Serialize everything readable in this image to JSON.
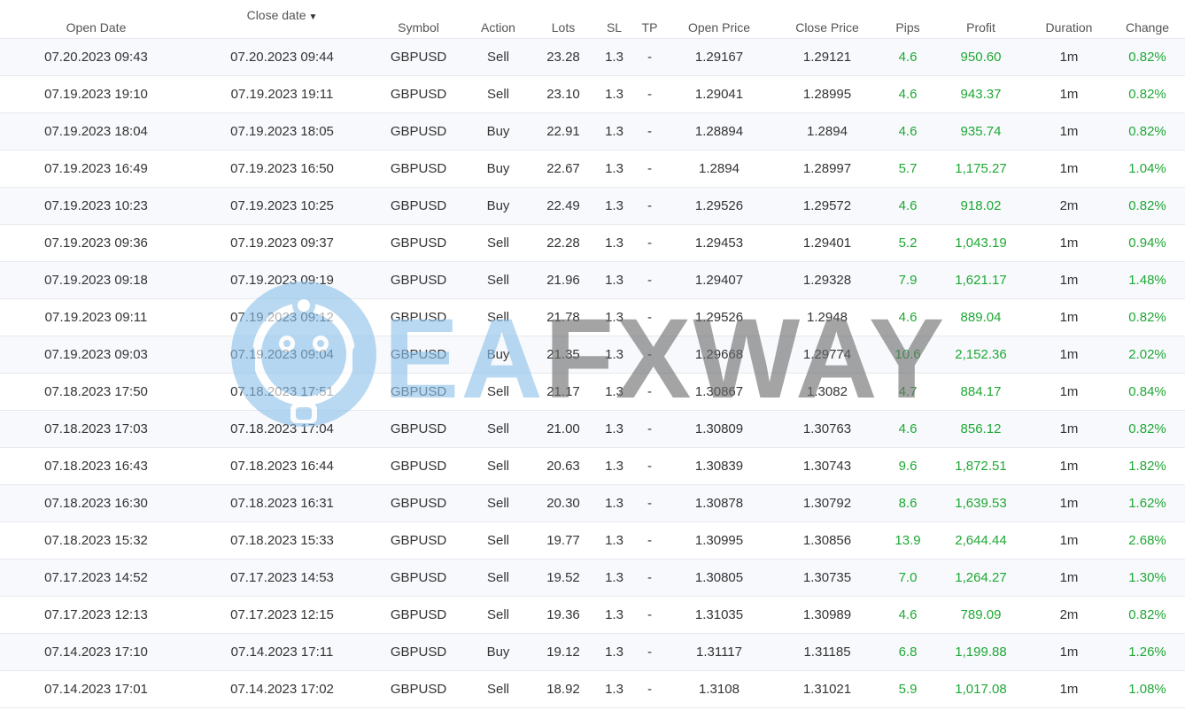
{
  "columns": [
    {
      "key": "open_date",
      "label": "Open Date"
    },
    {
      "key": "close_date",
      "label": "Close date"
    },
    {
      "key": "symbol",
      "label": "Symbol"
    },
    {
      "key": "action",
      "label": "Action"
    },
    {
      "key": "lots",
      "label": "Lots"
    },
    {
      "key": "sl",
      "label": "SL"
    },
    {
      "key": "tp",
      "label": "TP"
    },
    {
      "key": "open_price",
      "label": "Open Price"
    },
    {
      "key": "close_price",
      "label": "Close Price"
    },
    {
      "key": "pips",
      "label": "Pips"
    },
    {
      "key": "profit",
      "label": "Profit"
    },
    {
      "key": "duration",
      "label": "Duration"
    },
    {
      "key": "change",
      "label": "Change"
    }
  ],
  "sort": {
    "column": "close_date",
    "direction": "desc",
    "icon": "caret-down-icon"
  },
  "colors": {
    "positive": "#1ea834",
    "row_stripe": "#f7f9fc",
    "watermark_blue": "#8ec2ea",
    "watermark_gray": "#6d6d6d"
  },
  "watermark": {
    "part1": "EA",
    "part2": "FXWAY",
    "logo_icon": "robot-logo-icon"
  },
  "rows": [
    {
      "open_date": "07.20.2023 09:43",
      "close_date": "07.20.2023 09:44",
      "symbol": "GBPUSD",
      "action": "Sell",
      "lots": "23.28",
      "sl": "1.3",
      "tp": "-",
      "open_price": "1.29167",
      "close_price": "1.29121",
      "pips": "4.6",
      "profit": "950.60",
      "duration": "1m",
      "change": "0.82%"
    },
    {
      "open_date": "07.19.2023 19:10",
      "close_date": "07.19.2023 19:11",
      "symbol": "GBPUSD",
      "action": "Sell",
      "lots": "23.10",
      "sl": "1.3",
      "tp": "-",
      "open_price": "1.29041",
      "close_price": "1.28995",
      "pips": "4.6",
      "profit": "943.37",
      "duration": "1m",
      "change": "0.82%"
    },
    {
      "open_date": "07.19.2023 18:04",
      "close_date": "07.19.2023 18:05",
      "symbol": "GBPUSD",
      "action": "Buy",
      "lots": "22.91",
      "sl": "1.3",
      "tp": "-",
      "open_price": "1.28894",
      "close_price": "1.2894",
      "pips": "4.6",
      "profit": "935.74",
      "duration": "1m",
      "change": "0.82%"
    },
    {
      "open_date": "07.19.2023 16:49",
      "close_date": "07.19.2023 16:50",
      "symbol": "GBPUSD",
      "action": "Buy",
      "lots": "22.67",
      "sl": "1.3",
      "tp": "-",
      "open_price": "1.2894",
      "close_price": "1.28997",
      "pips": "5.7",
      "profit": "1,175.27",
      "duration": "1m",
      "change": "1.04%"
    },
    {
      "open_date": "07.19.2023 10:23",
      "close_date": "07.19.2023 10:25",
      "symbol": "GBPUSD",
      "action": "Buy",
      "lots": "22.49",
      "sl": "1.3",
      "tp": "-",
      "open_price": "1.29526",
      "close_price": "1.29572",
      "pips": "4.6",
      "profit": "918.02",
      "duration": "2m",
      "change": "0.82%"
    },
    {
      "open_date": "07.19.2023 09:36",
      "close_date": "07.19.2023 09:37",
      "symbol": "GBPUSD",
      "action": "Sell",
      "lots": "22.28",
      "sl": "1.3",
      "tp": "-",
      "open_price": "1.29453",
      "close_price": "1.29401",
      "pips": "5.2",
      "profit": "1,043.19",
      "duration": "1m",
      "change": "0.94%"
    },
    {
      "open_date": "07.19.2023 09:18",
      "close_date": "07.19.2023 09:19",
      "symbol": "GBPUSD",
      "action": "Sell",
      "lots": "21.96",
      "sl": "1.3",
      "tp": "-",
      "open_price": "1.29407",
      "close_price": "1.29328",
      "pips": "7.9",
      "profit": "1,621.17",
      "duration": "1m",
      "change": "1.48%"
    },
    {
      "open_date": "07.19.2023 09:11",
      "close_date": "07.19.2023 09:12",
      "symbol": "GBPUSD",
      "action": "Sell",
      "lots": "21.78",
      "sl": "1.3",
      "tp": "-",
      "open_price": "1.29526",
      "close_price": "1.2948",
      "pips": "4.6",
      "profit": "889.04",
      "duration": "1m",
      "change": "0.82%"
    },
    {
      "open_date": "07.19.2023 09:03",
      "close_date": "07.19.2023 09:04",
      "symbol": "GBPUSD",
      "action": "Buy",
      "lots": "21.35",
      "sl": "1.3",
      "tp": "-",
      "open_price": "1.29668",
      "close_price": "1.29774",
      "pips": "10.6",
      "profit": "2,152.36",
      "duration": "1m",
      "change": "2.02%"
    },
    {
      "open_date": "07.18.2023 17:50",
      "close_date": "07.18.2023 17:51",
      "symbol": "GBPUSD",
      "action": "Sell",
      "lots": "21.17",
      "sl": "1.3",
      "tp": "-",
      "open_price": "1.30867",
      "close_price": "1.3082",
      "pips": "4.7",
      "profit": "884.17",
      "duration": "1m",
      "change": "0.84%"
    },
    {
      "open_date": "07.18.2023 17:03",
      "close_date": "07.18.2023 17:04",
      "symbol": "GBPUSD",
      "action": "Sell",
      "lots": "21.00",
      "sl": "1.3",
      "tp": "-",
      "open_price": "1.30809",
      "close_price": "1.30763",
      "pips": "4.6",
      "profit": "856.12",
      "duration": "1m",
      "change": "0.82%"
    },
    {
      "open_date": "07.18.2023 16:43",
      "close_date": "07.18.2023 16:44",
      "symbol": "GBPUSD",
      "action": "Sell",
      "lots": "20.63",
      "sl": "1.3",
      "tp": "-",
      "open_price": "1.30839",
      "close_price": "1.30743",
      "pips": "9.6",
      "profit": "1,872.51",
      "duration": "1m",
      "change": "1.82%"
    },
    {
      "open_date": "07.18.2023 16:30",
      "close_date": "07.18.2023 16:31",
      "symbol": "GBPUSD",
      "action": "Sell",
      "lots": "20.30",
      "sl": "1.3",
      "tp": "-",
      "open_price": "1.30878",
      "close_price": "1.30792",
      "pips": "8.6",
      "profit": "1,639.53",
      "duration": "1m",
      "change": "1.62%"
    },
    {
      "open_date": "07.18.2023 15:32",
      "close_date": "07.18.2023 15:33",
      "symbol": "GBPUSD",
      "action": "Sell",
      "lots": "19.77",
      "sl": "1.3",
      "tp": "-",
      "open_price": "1.30995",
      "close_price": "1.30856",
      "pips": "13.9",
      "profit": "2,644.44",
      "duration": "1m",
      "change": "2.68%"
    },
    {
      "open_date": "07.17.2023 14:52",
      "close_date": "07.17.2023 14:53",
      "symbol": "GBPUSD",
      "action": "Sell",
      "lots": "19.52",
      "sl": "1.3",
      "tp": "-",
      "open_price": "1.30805",
      "close_price": "1.30735",
      "pips": "7.0",
      "profit": "1,264.27",
      "duration": "1m",
      "change": "1.30%"
    },
    {
      "open_date": "07.17.2023 12:13",
      "close_date": "07.17.2023 12:15",
      "symbol": "GBPUSD",
      "action": "Sell",
      "lots": "19.36",
      "sl": "1.3",
      "tp": "-",
      "open_price": "1.31035",
      "close_price": "1.30989",
      "pips": "4.6",
      "profit": "789.09",
      "duration": "2m",
      "change": "0.82%"
    },
    {
      "open_date": "07.14.2023 17:10",
      "close_date": "07.14.2023 17:11",
      "symbol": "GBPUSD",
      "action": "Buy",
      "lots": "19.12",
      "sl": "1.3",
      "tp": "-",
      "open_price": "1.31117",
      "close_price": "1.31185",
      "pips": "6.8",
      "profit": "1,199.88",
      "duration": "1m",
      "change": "1.26%"
    },
    {
      "open_date": "07.14.2023 17:01",
      "close_date": "07.14.2023 17:02",
      "symbol": "GBPUSD",
      "action": "Sell",
      "lots": "18.92",
      "sl": "1.3",
      "tp": "-",
      "open_price": "1.3108",
      "close_price": "1.31021",
      "pips": "5.9",
      "profit": "1,017.08",
      "duration": "1m",
      "change": "1.08%"
    }
  ]
}
